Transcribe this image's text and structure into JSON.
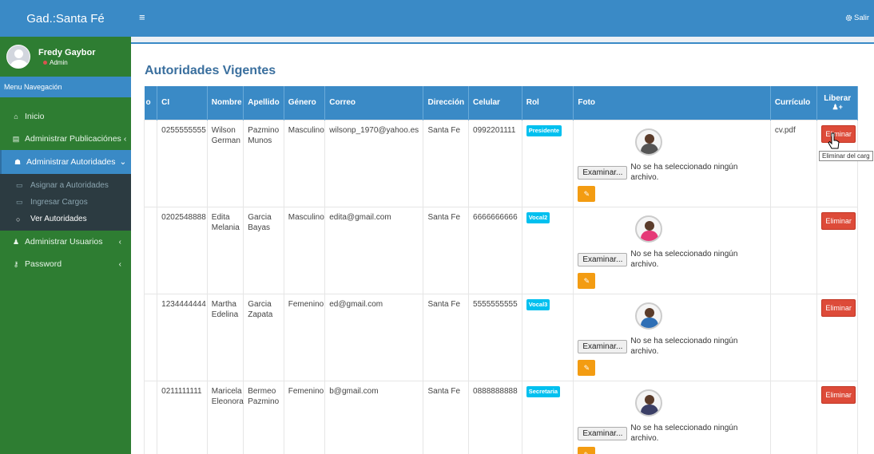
{
  "app": {
    "logo": "Gad.:Santa Fé",
    "menu_toggle_icon": "≡",
    "logout_label": "Salir"
  },
  "user": {
    "name": "Fredy Gaybor",
    "role": "Admin"
  },
  "sidebar": {
    "header": "Menu Navegación",
    "items": [
      {
        "label": "Inicio",
        "icon": "home-icon",
        "glyph": "⌂"
      },
      {
        "label": "Administrar Publicaciónes",
        "icon": "newspaper-icon",
        "glyph": "▤",
        "arrow": "‹"
      },
      {
        "label": "Administrar Autoridades",
        "icon": "users-icon",
        "glyph": "☗",
        "arrow": "⌄"
      },
      {
        "label": "Administrar Usuarios",
        "icon": "user-icon",
        "glyph": "♟",
        "arrow": "‹"
      },
      {
        "label": "Password",
        "icon": "key-icon",
        "glyph": "⚷",
        "arrow": "‹"
      }
    ],
    "submenu": [
      {
        "label": "Asignar a Autoridades",
        "glyph": "▭"
      },
      {
        "label": "Ingresar Cargos",
        "glyph": "▭"
      },
      {
        "label": "Ver Autoridades",
        "glyph": "○"
      }
    ]
  },
  "page": {
    "title": "Autoridades Vigentes"
  },
  "table": {
    "headers": [
      "o",
      "CI",
      "Nombre",
      "Apellido",
      "Género",
      "Correo",
      "Dirección",
      "Celular",
      "Rol",
      "Foto",
      "Currículo",
      "Liberar"
    ],
    "rows": [
      {
        "ci": "0255555555",
        "nombre": "Wilson German",
        "apellido": "Pazmino Munos",
        "genero": "Masculino",
        "correo": "wilsonp_1970@yahoo.es",
        "direccion": "Santa Fe",
        "celular": "0992201111",
        "rol": "Presidente",
        "curriculo": "cv.pdf",
        "body_color": "#555"
      },
      {
        "ci": "0202548888",
        "nombre": "Edita Melania",
        "apellido": "Garcia Bayas",
        "genero": "Masculino",
        "correo": "edita@gmail.com",
        "direccion": "Santa Fe",
        "celular": "6666666666",
        "rol": "Vocal2",
        "curriculo": "",
        "body_color": "#e53977"
      },
      {
        "ci": "1234444444",
        "nombre": "Martha Edelina",
        "apellido": "Garcia Zapata",
        "genero": "Femenino",
        "correo": "ed@gmail.com",
        "direccion": "Santa Fe",
        "celular": "5555555555",
        "rol": "Vocal3",
        "curriculo": "",
        "body_color": "#2f6fb5"
      },
      {
        "ci": "0211111111",
        "nombre": "Maricela Eleonora",
        "apellido": "Bermeo Pazmino",
        "genero": "Femenino",
        "correo": "b@gmail.com",
        "direccion": "Santa Fe",
        "celular": "0888888888",
        "rol": "Secretaria",
        "curriculo": "",
        "body_color": "#3b3f66"
      }
    ],
    "browse_label": "Examinar...",
    "no_file_text": "No se ha seleccionado ningún archivo.",
    "delete_label": "Eliminar",
    "edit_glyph": "✎"
  },
  "tooltip": {
    "text": "Eliminar del carg"
  },
  "colors": {
    "primary": "#3a8ac6",
    "sidebar": "#2e7d32",
    "danger": "#dd4b39",
    "info": "#00c0ef",
    "warning": "#f39c12"
  }
}
